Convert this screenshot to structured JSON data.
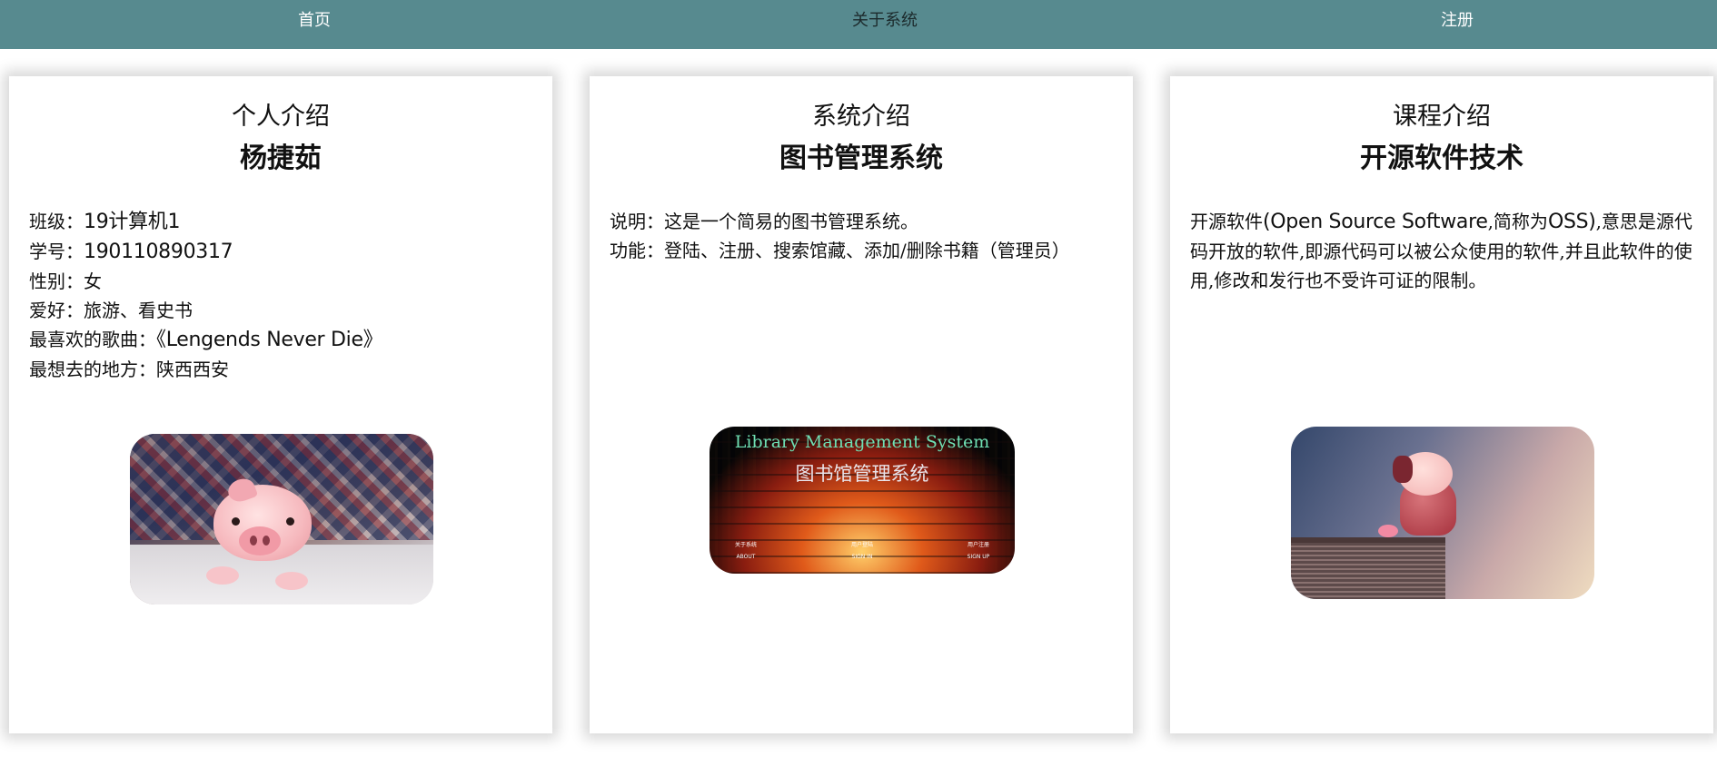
{
  "nav": {
    "home": "首页",
    "about": "关于系统",
    "register": "注册"
  },
  "colors": {
    "nav_bg": "#578a8f",
    "card_bg": "#ffffff",
    "lib_title": "#6fe0b4"
  },
  "cards": [
    {
      "title": "个人介绍",
      "subtitle": "杨捷茹",
      "lines": [
        {
          "label": "班级：",
          "value": "19计算机1"
        },
        {
          "label": "学号：",
          "value": "190110890317"
        },
        {
          "label": "性别：",
          "value": "女"
        },
        {
          "label": "爱好：",
          "value": "旅游、看史书"
        },
        {
          "label": "最喜欢的歌曲：",
          "value": "《Lengends Never Die》"
        },
        {
          "label": "最想去的地方：",
          "value": "陕西西安"
        }
      ],
      "image_icon": "sleeping-pig-image"
    },
    {
      "title": "系统介绍",
      "subtitle": "图书管理系统",
      "lines": [
        {
          "label": "说明：",
          "value": "这是一个简易的图书管理系统。"
        },
        {
          "label": "功能：",
          "value": "登陆、注册、搜索馆藏、添加/删除书籍（管理员）"
        }
      ],
      "image": {
        "title": "Library Management System",
        "subtitle": "图书馆管理系统",
        "links": [
          {
            "cn": "关于系统",
            "en": "ABOUT"
          },
          {
            "cn": "用户登陆",
            "en": "SIGN IN"
          },
          {
            "cn": "用户注册",
            "en": "SIGN UP"
          }
        ]
      }
    },
    {
      "title": "课程介绍",
      "subtitle": "开源软件技术",
      "text_parts": [
        "开源软件",
        "(Open Source Software",
        ",简称为",
        "OSS)",
        ",意思是源代码开放的软件,即源代码可以被公众使用的软件,并且此软件的使用,修改和发行也不受许可证的限制。"
      ],
      "image_icon": "pig-on-book-image"
    }
  ]
}
